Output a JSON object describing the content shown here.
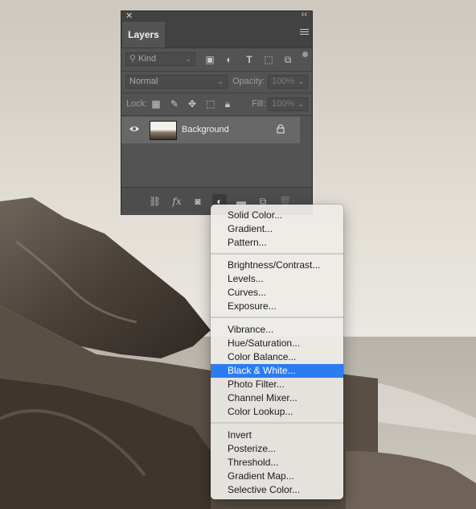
{
  "panel": {
    "title": "Layers",
    "filter": {
      "kind_label": "Kind"
    },
    "blend_mode": "Normal",
    "opacity_label": "Opacity:",
    "opacity_value": "100%",
    "lock_label": "Lock:",
    "fill_label": "Fill:",
    "fill_value": "100%",
    "layers": [
      {
        "name": "Background",
        "visible": true,
        "locked": true
      }
    ]
  },
  "menu": {
    "groups": [
      [
        "Solid Color...",
        "Gradient...",
        "Pattern..."
      ],
      [
        "Brightness/Contrast...",
        "Levels...",
        "Curves...",
        "Exposure..."
      ],
      [
        "Vibrance...",
        "Hue/Saturation...",
        "Color Balance...",
        "Black & White...",
        "Photo Filter...",
        "Channel Mixer...",
        "Color Lookup..."
      ],
      [
        "Invert",
        "Posterize...",
        "Threshold...",
        "Gradient Map...",
        "Selective Color..."
      ]
    ],
    "highlighted": "Black & White..."
  },
  "colors": {
    "panel_bg": "#535353",
    "highlight": "#2b7cf0"
  }
}
